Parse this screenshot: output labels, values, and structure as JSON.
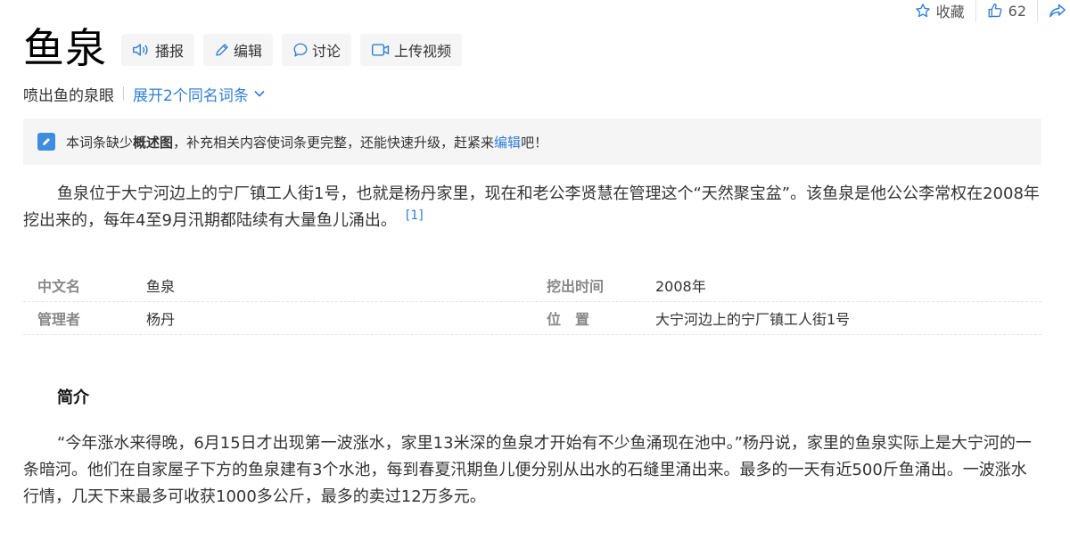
{
  "top_actions": {
    "favorite_label": "收藏",
    "like_count": "62"
  },
  "title": "鱼泉",
  "tools": {
    "broadcast": "播报",
    "edit": "编辑",
    "discuss": "讨论",
    "upload_video": "上传视频"
  },
  "subtitle": {
    "text": "喷出鱼的泉眼",
    "expand_link": "展开2个同名词条"
  },
  "notice": {
    "prefix": "本词条缺少",
    "bold": "概述图",
    "middle": "，补充相关内容使词条更完整，还能快速升级，赶紧来",
    "link": "编辑",
    "suffix": "吧！"
  },
  "summary": {
    "text": "鱼泉位于大宁河边上的宁厂镇工人街1号，也就是杨丹家里，现在和老公李贤慧在管理这个“天然聚宝盆”。该鱼泉是他公公李常权在2008年挖出来的，每年4至9月汛期都陆续有大量鱼儿涌出。",
    "ref": "[1]"
  },
  "info": {
    "rows": [
      {
        "k1": "中文名",
        "v1": "鱼泉",
        "k2": "挖出时间",
        "v2": "2008年"
      },
      {
        "k1": "管理者",
        "v1": "杨丹",
        "k2": "位　置",
        "v2": "大宁河边上的宁厂镇工人街1号"
      }
    ]
  },
  "section": {
    "heading": "简介",
    "text": "“今年涨水来得晚，6月15日才出现第一波涨水，家里13米深的鱼泉才开始有不少鱼涌现在池中。”杨丹说，家里的鱼泉实际上是大宁河的一条暗河。他们在自家屋子下方的鱼泉建有3个水池，每到春夏汛期鱼儿便分别从出水的石缝里涌出来。最多的一天有近500斤鱼涌出。一波涨水行情，几天下来最多可收获1000多公斤，最多的卖过12万多元。"
  },
  "colors": {
    "link": "#2f7fd6",
    "notice_bg": "#f5f5f5",
    "tool_bg": "#f5f5f5"
  }
}
